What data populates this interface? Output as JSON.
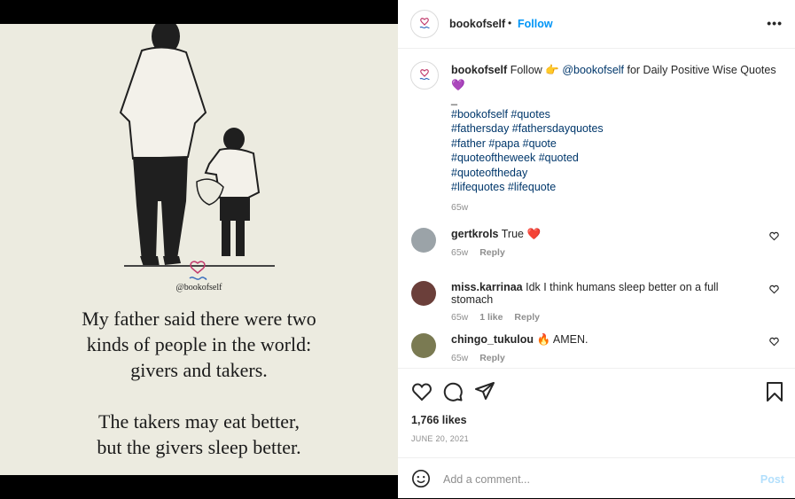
{
  "header": {
    "username": "bookofself",
    "separator": "•",
    "follow_label": "Follow",
    "more_icon": "more-icon"
  },
  "image": {
    "handle": "@bookofself",
    "quote_lines": [
      "My father said there were two",
      "kinds of people in the world:",
      "givers and takers."
    ],
    "quote_lines2": [
      "The takers may eat better,",
      "but the givers sleep better."
    ]
  },
  "caption": {
    "username": "bookofself",
    "text1": "Follow 👉",
    "mention": "@bookofself",
    "text2": "for Daily Positive Wise Quotes 💜",
    "underscore": "_",
    "hashtag_lines": [
      "#bookofself #quotes",
      "#fathersday #fathersdayquotes",
      "#father #papa #quote",
      "#quoteoftheweek #quoted",
      "#quoteoftheday",
      "#lifequotes #lifequote"
    ],
    "age": "65w"
  },
  "comments": [
    {
      "username": "gertkrols",
      "text": "True ❤️",
      "age": "65w",
      "likes": "",
      "reply": "Reply"
    },
    {
      "username": "miss.karrinaa",
      "text": "Idk I think humans sleep better on a full stomach",
      "age": "65w",
      "likes": "1 like",
      "reply": "Reply"
    },
    {
      "username": "chingo_tukulou",
      "text": "🔥 AMEN.",
      "age": "65w",
      "likes": "",
      "reply": "Reply"
    }
  ],
  "actions": {
    "likes": "1,766 likes",
    "date": "JUNE 20, 2021"
  },
  "add_comment": {
    "placeholder": "Add a comment...",
    "post_label": "Post"
  },
  "colors": {
    "link_blue": "#0095f6",
    "hashtag": "#00376b",
    "meta_gray": "#8e8e8e",
    "heart_red": "#ed4956"
  }
}
